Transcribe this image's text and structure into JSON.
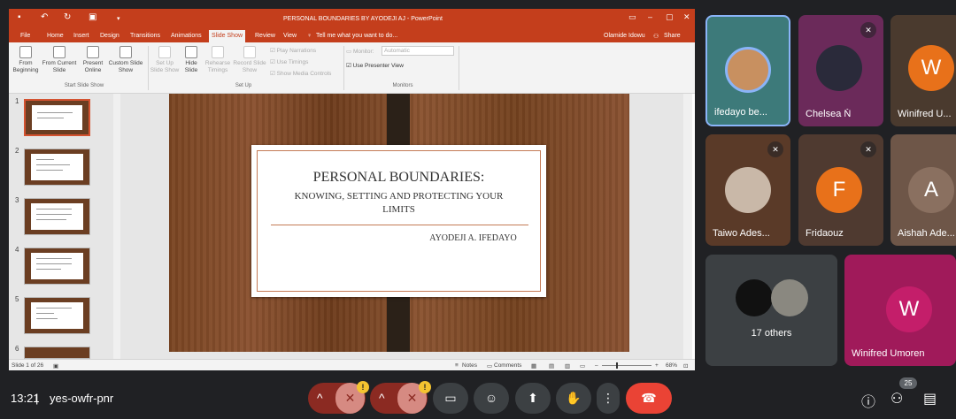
{
  "powerpoint": {
    "window_title": "PERSONAL BOUNDARIES BY AYODEJI AJ - PowerPoint",
    "menu_tabs": [
      "File",
      "Home",
      "Insert",
      "Design",
      "Transitions",
      "Animations",
      "Slide Show",
      "Review",
      "View"
    ],
    "active_tab": "Slide Show",
    "tell_me": "Tell me what you want to do...",
    "user": "Olamide Idowu",
    "share": "Share",
    "ribbon": {
      "from_beginning": "From Beginning",
      "from_current": "From Current Slide",
      "present_online": "Present Online",
      "custom_show": "Custom Slide Show",
      "group_start": "Start Slide Show",
      "setup_show": "Set Up Slide Show",
      "hide_slide": "Hide Slide",
      "rehearse": "Rehearse Timings",
      "record": "Record Slide Show",
      "play_narrations": "Play Narrations",
      "use_timings": "Use Timings",
      "show_media": "Show Media Controls",
      "group_setup": "Set Up",
      "monitor_label": "Monitor:",
      "monitor_value": "Automatic",
      "presenter_view": "Use Presenter View",
      "group_monitors": "Monitors"
    },
    "slide_numbers": [
      "1",
      "2",
      "3",
      "4",
      "5",
      "6"
    ],
    "slide": {
      "title": "PERSONAL BOUNDARIES:",
      "subtitle_line1": "KNOWING, SETTING AND PROTECTING YOUR",
      "subtitle_line2": "LIMITS",
      "author": "AYODEJI A. IFEDAYO"
    },
    "status": {
      "slide_count": "Slide 1 of 26",
      "notes": "Notes",
      "comments": "Comments",
      "zoom": "68%"
    }
  },
  "participants": [
    {
      "name": "ifedayo be...",
      "initial": "",
      "color": "#3d7a7a"
    },
    {
      "name": "Chelsea Ň",
      "initial": "",
      "color": "#6b2a5a"
    },
    {
      "name": "Winifred U...",
      "initial": "W",
      "color": "#e8711a"
    },
    {
      "name": "Taiwo Ades...",
      "initial": "",
      "color": "#5a3a28"
    },
    {
      "name": "Fridaouz",
      "initial": "F",
      "color": "#e8711a"
    },
    {
      "name": "Aishah Ade...",
      "initial": "A",
      "color": "#6e5648"
    }
  ],
  "others": {
    "label": "17 others"
  },
  "self_tile": {
    "name": "Winifred Umoren",
    "initial": "W"
  },
  "meeting": {
    "time": "13:21",
    "code": "yes-owfr-pnr",
    "participant_count": "25"
  },
  "colors": {
    "accent": "#c43e1c",
    "end_call": "#ea4335",
    "tile_bg": "#3c4043"
  }
}
